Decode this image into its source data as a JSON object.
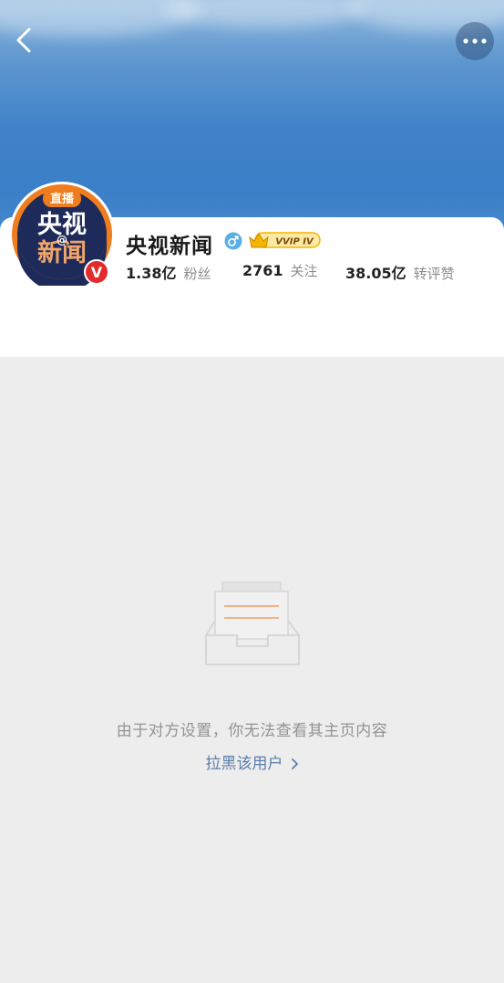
{
  "header": {
    "back_icon": "chevron-left-icon",
    "more_icon": "more-dots-icon"
  },
  "profile": {
    "avatar": {
      "top_label": "直播",
      "line1": "央视",
      "line2": "新闻",
      "at_symbol": "@",
      "verified_badge": "V"
    },
    "name": "央视新闻",
    "gender_icon": "male-icon",
    "vip_badge": "VVIP IV",
    "stats": {
      "followers_value": "1.38亿",
      "followers_label": "粉丝",
      "following_value": "2761",
      "following_label": "关注",
      "interactions_value": "38.05亿",
      "interactions_label": "转评赞"
    }
  },
  "empty_state": {
    "icon": "empty-inbox-icon",
    "message": "由于对方设置，你无法查看其主页内容",
    "block_label": "拉黑该用户",
    "block_chevron": "chevron-right-icon"
  },
  "colors": {
    "avatar_orange": "#ef7d1e",
    "avatar_navy": "#1e2a5a",
    "verified_red": "#e42b2b",
    "vip_gold": "#f5b400",
    "link_blue": "#5a7eaa",
    "empty_bg": "#ededed"
  }
}
